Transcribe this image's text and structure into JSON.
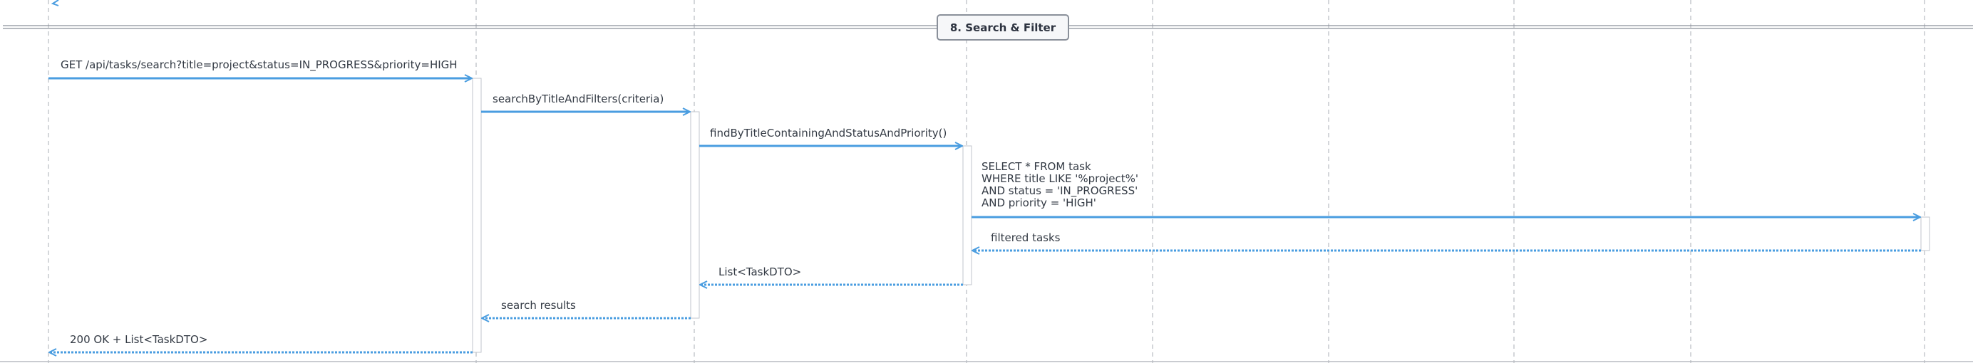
{
  "section": {
    "title": "8. Search & Filter"
  },
  "messages": [
    {
      "label": "GET /api/tasks/search?title=project&status=IN_PROGRESS&priority=HIGH",
      "kind": "request"
    },
    {
      "label": "searchByTitleAndFilters(criteria)",
      "kind": "request"
    },
    {
      "label": "findByTitleContainingAndStatusAndPriority()",
      "kind": "request"
    },
    {
      "label_lines": [
        "SELECT * FROM task",
        "WHERE title LIKE '%project%'",
        "AND status = 'IN_PROGRESS'",
        "AND priority = 'HIGH'"
      ],
      "kind": "request"
    },
    {
      "label": "filtered tasks",
      "kind": "response"
    },
    {
      "label": "List<TaskDTO>",
      "kind": "response"
    },
    {
      "label": "search results",
      "kind": "response"
    },
    {
      "label": "200 OK + List<TaskDTO>",
      "kind": "response"
    }
  ],
  "colors": {
    "arrow": "#4a9de0",
    "lifeline": "#b8bcc2",
    "activation_border": "#c2c6cc",
    "frame_border": "#8a909a",
    "divider": "#8a909a"
  }
}
